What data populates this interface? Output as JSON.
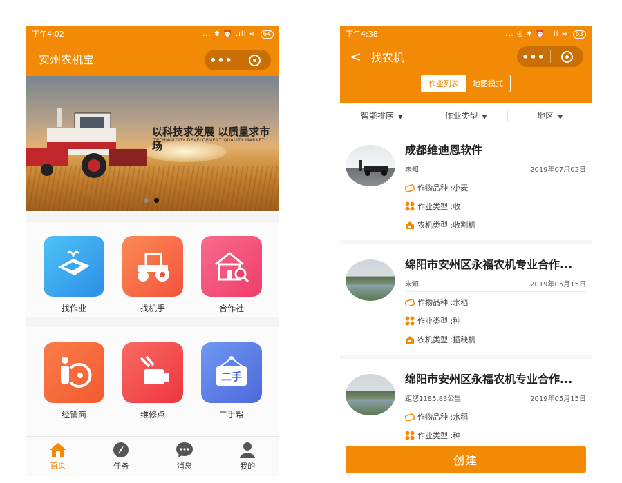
{
  "left": {
    "status": {
      "time": "下午4:02",
      "icons": "... ✱ ⏰ .ıll ≋",
      "battery": "64"
    },
    "nav": {
      "title": "安州农机宝"
    },
    "banner": {
      "headline": "以科技求发展  以质量求市场",
      "subline": "TECHNOLOGY DEVELOPMENT QUALITY MARKET",
      "page_count": 2,
      "active_page": 2
    },
    "grid": [
      {
        "label": "找作业",
        "icon": "field-icon",
        "color": "#3aa9ef"
      },
      {
        "label": "找机手",
        "icon": "tractor-icon",
        "color": "#f9674a"
      },
      {
        "label": "合作社",
        "icon": "house-search-icon",
        "color": "#f2557a"
      },
      {
        "label": "经销商",
        "icon": "dealer-icon",
        "color": "#f5683d"
      },
      {
        "label": "维修点",
        "icon": "wrench-icon",
        "color": "#f34d50"
      },
      {
        "label": "二手帮",
        "icon": "second-hand-sign-icon",
        "color": "#5a7ee8",
        "sign_text": "二手"
      }
    ],
    "tabs": [
      {
        "label": "首页",
        "icon": "home-icon",
        "active": true
      },
      {
        "label": "任务",
        "icon": "compass-icon",
        "active": false
      },
      {
        "label": "消息",
        "icon": "chat-bubble-icon",
        "active": false
      },
      {
        "label": "我的",
        "icon": "person-icon",
        "active": false
      }
    ]
  },
  "right": {
    "status": {
      "time": "下午4:38",
      "icons": "... ◎ ✱ ⏰ .ıll ≋",
      "battery": "63"
    },
    "nav": {
      "back": "<",
      "title": "找农机"
    },
    "segments": {
      "list": "作业列表",
      "map": "地图模式"
    },
    "filters": [
      "智能排序",
      "作业类型",
      "地区"
    ],
    "cards": [
      {
        "title": "成都维迪恩软件",
        "meta_left": "未知",
        "date": "2019年07月02日",
        "crop": "作物品种 :小麦",
        "work": "作业类型 :收",
        "machine": "农机类型 :收割机",
        "avatar": "car"
      },
      {
        "title": "绵阳市安州区永福农机专业合作...",
        "meta_left": "未知",
        "date": "2019年05月15日",
        "crop": "作物品种 :水稻",
        "work": "作业类型 :种",
        "machine": "农机类型 :插秧机",
        "avatar": "lake"
      },
      {
        "title": "绵阳市安州区永福农机专业合作...",
        "meta_left": "距您1185.83公里",
        "date": "2019年05月15日",
        "crop": "作物品种 :水稻",
        "work": "作业类型 :种",
        "avatar": "lake"
      }
    ],
    "create_label": "创建"
  },
  "colors": {
    "primary": "#f28a06",
    "capsule": "#c96f05"
  }
}
